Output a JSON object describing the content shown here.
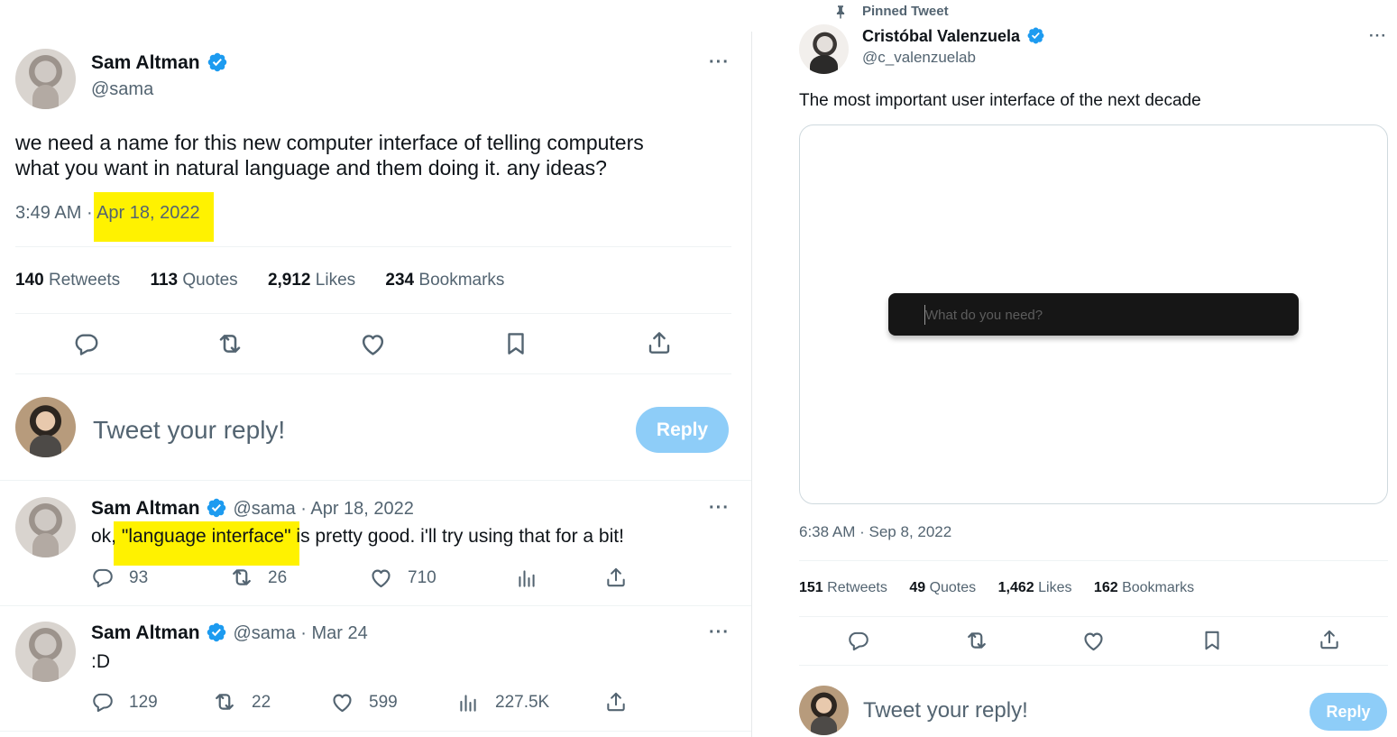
{
  "left": {
    "main_tweet": {
      "author_name": "Sam Altman",
      "author_handle": "@sama",
      "text_line1": "we need a name for this new computer interface of telling computers",
      "text_line2": "what you want in natural language and them doing it. any ideas?",
      "time": "3:49 AM",
      "separator": "·",
      "date": "Apr 18, 2022",
      "stats": [
        {
          "count": "140",
          "label": "Retweets"
        },
        {
          "count": "113",
          "label": "Quotes"
        },
        {
          "count": "2,912",
          "label": "Likes"
        },
        {
          "count": "234",
          "label": "Bookmarks"
        }
      ],
      "more_label": "···"
    },
    "composer": {
      "placeholder": "Tweet your reply!",
      "reply_label": "Reply"
    },
    "replies": [
      {
        "author_name": "Sam Altman",
        "handle_date": "@sama · Apr 18, 2022",
        "text_prefix": "ok, ",
        "text_highlight": "\"language interface\"",
        "text_suffix": " is pretty good. i'll try using that for a bit!",
        "replies": "93",
        "retweets": "26",
        "likes": "710",
        "views": ""
      },
      {
        "author_name": "Sam Altman",
        "handle_date": "@sama · Mar 24",
        "text": ":D",
        "replies": "129",
        "retweets": "22",
        "likes": "599",
        "views": "227.5K"
      }
    ]
  },
  "right": {
    "pinned_label": "Pinned Tweet",
    "author_name": "Cristóbal Valenzuela",
    "author_handle": "@c_valenzuelab",
    "text": "The most important user interface of the next decade",
    "media": {
      "input_placeholder": "What do you need?"
    },
    "time": "6:38 AM",
    "separator": "·",
    "date": "Sep 8, 2022",
    "stats": [
      {
        "count": "151",
        "label": "Retweets"
      },
      {
        "count": "49",
        "label": "Quotes"
      },
      {
        "count": "1,462",
        "label": "Likes"
      },
      {
        "count": "162",
        "label": "Bookmarks"
      }
    ],
    "more_label": "···",
    "composer": {
      "placeholder": "Tweet your reply!",
      "reply_label": "Reply"
    }
  },
  "colors": {
    "verified_blue": "#1d9bf0",
    "highlight_yellow": "#fff200",
    "reply_button": "#8ecdf8",
    "secondary_text": "#536471"
  },
  "icons": [
    "verified-badge-icon",
    "more-icon",
    "reply-icon",
    "retweet-icon",
    "like-icon",
    "bookmark-icon",
    "share-icon",
    "views-icon",
    "pin-icon"
  ]
}
